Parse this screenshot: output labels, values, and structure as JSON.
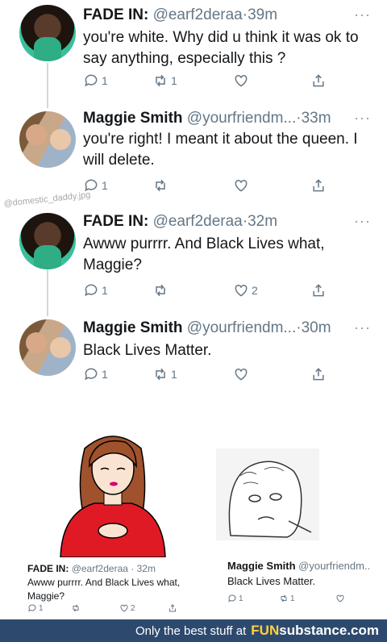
{
  "tweets": [
    {
      "name": "FADE IN:",
      "handle": "@earf2deraa",
      "dot": "·",
      "time": "39m",
      "more": "···",
      "text": "you're white. Why did u think it was ok to say anything, especially this ?",
      "reply": "1",
      "retweet": "1",
      "like": ""
    },
    {
      "name": "Maggie Smith",
      "handle": "@yourfriendm...",
      "dot": "·",
      "time": "33m",
      "more": "···",
      "text": "you're right! I meant it about the queen. I will delete.",
      "reply": "1",
      "retweet": "",
      "like": ""
    },
    {
      "name": "FADE IN:",
      "handle": "@earf2deraa",
      "dot": "·",
      "time": "32m",
      "more": "···",
      "text": "Awww purrrr. And Black Lives what, Maggie?",
      "reply": "1",
      "retweet": "",
      "like": "2"
    },
    {
      "name": "Maggie Smith",
      "handle": "@yourfriendm...",
      "dot": "·",
      "time": "30m",
      "more": "···",
      "text": "Black Lives Matter.",
      "reply": "1",
      "retweet": "1",
      "like": ""
    }
  ],
  "watermark": "@domestic_daddy.jpg",
  "meme": {
    "left": {
      "name": "FADE IN:",
      "handle": "@earf2deraa",
      "time": "· 32m",
      "text": "Awww purrrr. And Black Lives what, Maggie?",
      "reply": "1",
      "like": "2"
    },
    "right": {
      "name": "Maggie Smith",
      "handle": "@yourfriendm..",
      "text": "Black Lives Matter.",
      "reply": "1",
      "retweet": "1"
    }
  },
  "footer": {
    "tagline": "Only the best stuff at",
    "brand_a": "FUN",
    "brand_b": "substance.com"
  },
  "colors": {
    "footer_bg": "#2d4a6e",
    "brand_accent": "#ffd23f",
    "meme_red": "#e01a24"
  }
}
